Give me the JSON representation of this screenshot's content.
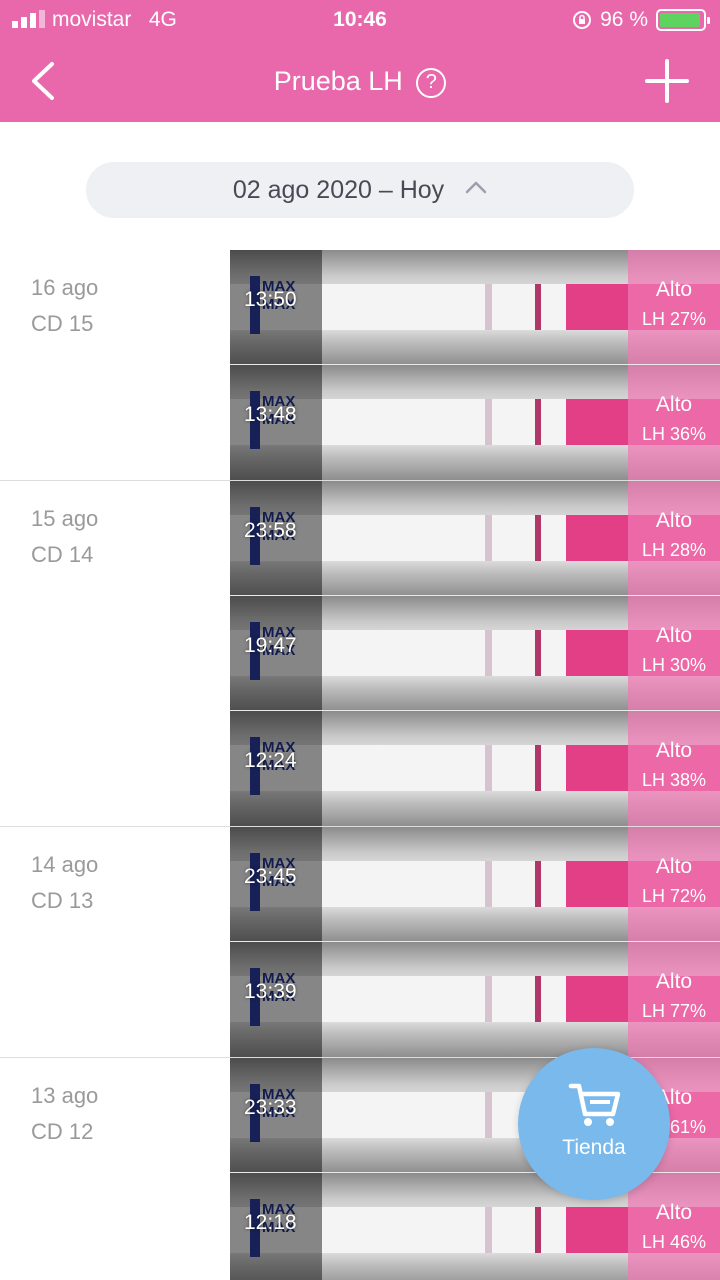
{
  "status_bar": {
    "carrier": "movistar",
    "network": "4G",
    "time": "10:46",
    "battery_text": "96 %",
    "battery_level": 0.96
  },
  "header": {
    "title": "Prueba LH",
    "help_glyph": "?",
    "back_icon": "chevron-left-icon",
    "add_icon": "plus-icon",
    "background": "#e868ab"
  },
  "date_selector": {
    "label": "02 ago 2020 – Hoy",
    "icon": "chevron-up-icon"
  },
  "days": [
    {
      "date": "16 ago",
      "cycle_day": "CD 15",
      "entries": [
        {
          "time": "13:50",
          "level": "Alto",
          "lh": "LH 27%"
        },
        {
          "time": "13:48",
          "level": "Alto",
          "lh": "LH 36%"
        }
      ]
    },
    {
      "date": "15 ago",
      "cycle_day": "CD 14",
      "entries": [
        {
          "time": "23:58",
          "level": "Alto",
          "lh": "LH 28%"
        },
        {
          "time": "19:47",
          "level": "Alto",
          "lh": "LH 30%"
        },
        {
          "time": "12:24",
          "level": "Alto",
          "lh": "LH 38%"
        }
      ]
    },
    {
      "date": "14 ago",
      "cycle_day": "CD 13",
      "entries": [
        {
          "time": "23:45",
          "level": "Alto",
          "lh": "LH 72%"
        },
        {
          "time": "13:39",
          "level": "Alto",
          "lh": "LH 77%"
        }
      ]
    },
    {
      "date": "13 ago",
      "cycle_day": "CD 12",
      "entries": [
        {
          "time": "23:33",
          "level": "Alto",
          "lh": "LH 61%"
        },
        {
          "time": "12:18",
          "level": "Alto",
          "lh": "LH 46%"
        }
      ]
    }
  ],
  "strip_text": "MAX",
  "fab": {
    "label": "Tienda",
    "icon": "shopping-cart-icon",
    "color": "#7ab9ec"
  }
}
